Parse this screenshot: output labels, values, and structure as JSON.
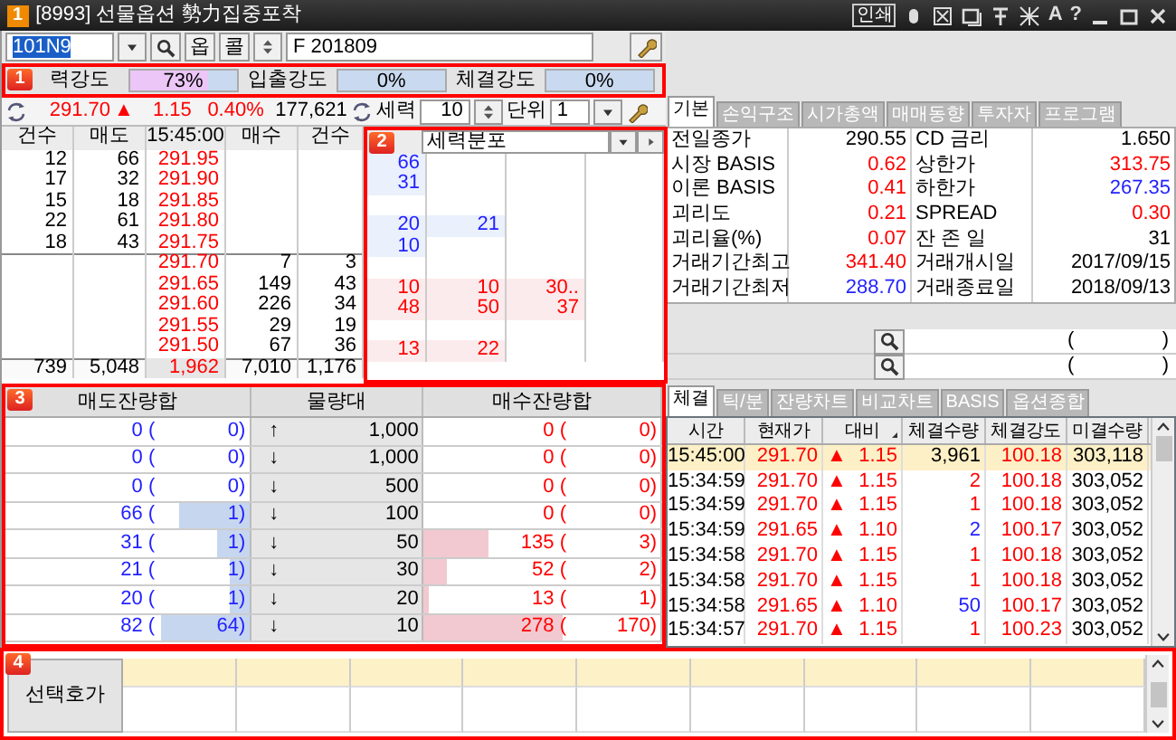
{
  "window": {
    "badge": "1",
    "title": "[8993] 선물옵션 勢力집중포착",
    "print_label": "인쇄",
    "tools": [
      "A",
      "?"
    ]
  },
  "toolbar": {
    "code": "101N9",
    "option_buttons": [
      "옵",
      "콜"
    ],
    "product": "F 201809"
  },
  "intensity": {
    "marker": "1",
    "items": [
      {
        "label": "력강도",
        "value": "73%",
        "level": 0.73
      },
      {
        "label": "입출강도",
        "value": "0%",
        "level": 0
      },
      {
        "label": "체결강도",
        "value": "0%",
        "level": 0
      }
    ]
  },
  "quote": {
    "price": "291.70",
    "arrow": "▲",
    "change": "1.15",
    "rate": "0.40%",
    "volume": "177,621",
    "force_label": "세력",
    "force_value": "10",
    "unit_label": "단위",
    "unit_value": "1"
  },
  "orderbook": {
    "columns": [
      "건수",
      "매도",
      "15:45:00",
      "매수",
      "건수"
    ],
    "asks": [
      {
        "count": "12",
        "qty": "66",
        "price": "291.95",
        "distribution": [
          "66"
        ]
      },
      {
        "count": "17",
        "qty": "32",
        "price": "291.90",
        "distribution": [
          "31"
        ]
      },
      {
        "count": "15",
        "qty": "18",
        "price": "291.85"
      },
      {
        "count": "22",
        "qty": "61",
        "price": "291.80",
        "distribution": [
          "20",
          "21"
        ]
      },
      {
        "count": "18",
        "qty": "43",
        "price": "291.75",
        "distribution": [
          "10"
        ]
      }
    ],
    "bids": [
      {
        "price": "291.70",
        "qty": "7",
        "count": "3"
      },
      {
        "price": "291.65",
        "qty": "149",
        "count": "43",
        "distribution": [
          "10",
          "10",
          "30.."
        ]
      },
      {
        "price": "291.60",
        "qty": "226",
        "count": "34",
        "distribution": [
          "48",
          "50",
          "37"
        ]
      },
      {
        "price": "291.55",
        "qty": "29",
        "count": "19"
      },
      {
        "price": "291.50",
        "qty": "67",
        "count": "36",
        "distribution": [
          "13",
          "22"
        ]
      }
    ],
    "totals": [
      "739",
      "5,048",
      "1,962",
      "7,010",
      "1,176"
    ]
  },
  "force_distribution": {
    "marker": "2",
    "select": "세력분포"
  },
  "remaining": {
    "marker": "3",
    "columns": [
      "매도잔량합",
      "물량대",
      "매수잔량합"
    ],
    "rows": [
      {
        "ask": {
          "qty": "0 (",
          "count": "0)",
          "level": 0
        },
        "arrow": "↑",
        "band": "1,000",
        "bid": {
          "qty": "0 (",
          "count": "0)",
          "level": 0
        }
      },
      {
        "ask": {
          "qty": "0 (",
          "count": "0)",
          "level": 0
        },
        "arrow": "↓",
        "band": "1,000",
        "bid": {
          "qty": "0 (",
          "count": "0)",
          "level": 0
        }
      },
      {
        "ask": {
          "qty": "0 (",
          "count": "0)",
          "level": 0
        },
        "arrow": "↓",
        "band": "500",
        "bid": {
          "qty": "0 (",
          "count": "0)",
          "level": 0
        }
      },
      {
        "ask": {
          "qty": "66 (",
          "count": "1)",
          "level": 0.29
        },
        "arrow": "↓",
        "band": "100",
        "bid": {
          "qty": "0 (",
          "count": "0)",
          "level": 0
        }
      },
      {
        "ask": {
          "qty": "31 (",
          "count": "1)",
          "level": 0.13
        },
        "arrow": "↓",
        "band": "50",
        "bid": {
          "qty": "135 (",
          "count": "3)",
          "level": 0.27
        }
      },
      {
        "ask": {
          "qty": "21 (",
          "count": "1)",
          "level": 0.08
        },
        "arrow": "↓",
        "band": "30",
        "bid": {
          "qty": "52 (",
          "count": "2)",
          "level": 0.1
        }
      },
      {
        "ask": {
          "qty": "20 (",
          "count": "1)",
          "level": 0.08
        },
        "arrow": "↓",
        "band": "20",
        "bid": {
          "qty": "13 (",
          "count": "1)",
          "level": 0.02
        }
      },
      {
        "ask": {
          "qty": "82 (",
          "count": "64)",
          "level": 0.36
        },
        "arrow": "↓",
        "band": "10",
        "bid": {
          "qty": "278 (",
          "count": "170)",
          "level": 0.59
        }
      }
    ]
  },
  "selected_quotes": {
    "marker": "4",
    "label": "선택호가"
  },
  "info_tabs": [
    {
      "label": "기본",
      "selected": true
    },
    {
      "label": "손익구조",
      "selected": false
    },
    {
      "label": "시가총액",
      "selected": false
    },
    {
      "label": "매매동향",
      "selected": false
    },
    {
      "label": "투자자",
      "selected": false
    },
    {
      "label": "프로그램",
      "selected": false
    }
  ],
  "info": [
    {
      "label": "전일종가",
      "value": "290.55",
      "rise": false,
      "fall": false
    },
    {
      "label": "CD 금리",
      "value": "1.650",
      "rise": false,
      "fall": false
    },
    {
      "label": "시장 BASIS",
      "value": "0.62",
      "rise": true,
      "fall": false
    },
    {
      "label": "상한가",
      "value": "313.75",
      "rise": true,
      "fall": false
    },
    {
      "label": "이론 BASIS",
      "value": "0.41",
      "rise": true,
      "fall": false
    },
    {
      "label": "하한가",
      "value": "267.35",
      "rise": false,
      "fall": true
    },
    {
      "label": "괴리도",
      "value": "0.21",
      "rise": true,
      "fall": false
    },
    {
      "label": "SPREAD",
      "value": "0.30",
      "rise": true,
      "fall": false
    },
    {
      "label": "괴리율(%)",
      "value": "0.07",
      "rise": true,
      "fall": false
    },
    {
      "label": "잔 존 일",
      "value": "31",
      "rise": false,
      "fall": false
    },
    {
      "label": "거래기간최고",
      "value": "341.40",
      "rise": true,
      "fall": false
    },
    {
      "label": "거래개시일",
      "value": "2017/09/15",
      "rise": false,
      "fall": false
    },
    {
      "label": "거래기간최저",
      "value": "288.70",
      "rise": false,
      "fall": true
    },
    {
      "label": "거래종료일",
      "value": "2018/09/13",
      "rise": false,
      "fall": false
    }
  ],
  "lookups": [
    {
      "open": "(",
      "close": ")"
    },
    {
      "open": "(",
      "close": ")"
    }
  ],
  "trade_tabs": [
    {
      "label": "체결",
      "selected": true
    },
    {
      "label": "틱/분",
      "selected": false
    },
    {
      "label": "잔량차트",
      "selected": false
    },
    {
      "label": "비교차트",
      "selected": false
    },
    {
      "label": "BASIS",
      "selected": false
    },
    {
      "label": "옵션종합",
      "selected": false
    }
  ],
  "trades": {
    "columns": [
      "시간",
      "현재가",
      "대비",
      "체결수량",
      "체결강도",
      "미결수량"
    ],
    "rows": [
      {
        "time": "15:45:00",
        "price": "291.70",
        "arrow": "▲",
        "change": "1.15",
        "qty": "3,961",
        "qty_rise": false,
        "qty_fall": false,
        "strength": "100.18",
        "open_interest": "303,118",
        "selected": true
      },
      {
        "time": "15:34:59",
        "price": "291.70",
        "arrow": "▲",
        "change": "1.15",
        "qty": "2",
        "qty_rise": true,
        "qty_fall": false,
        "strength": "100.18",
        "open_interest": "303,052",
        "selected": false
      },
      {
        "time": "15:34:59",
        "price": "291.70",
        "arrow": "▲",
        "change": "1.15",
        "qty": "1",
        "qty_rise": true,
        "qty_fall": false,
        "strength": "100.18",
        "open_interest": "303,052",
        "selected": false
      },
      {
        "time": "15:34:59",
        "price": "291.65",
        "arrow": "▲",
        "change": "1.10",
        "qty": "2",
        "qty_rise": false,
        "qty_fall": true,
        "strength": "100.17",
        "open_interest": "303,052",
        "selected": false
      },
      {
        "time": "15:34:58",
        "price": "291.70",
        "arrow": "▲",
        "change": "1.15",
        "qty": "1",
        "qty_rise": true,
        "qty_fall": false,
        "strength": "100.18",
        "open_interest": "303,052",
        "selected": false
      },
      {
        "time": "15:34:58",
        "price": "291.70",
        "arrow": "▲",
        "change": "1.15",
        "qty": "1",
        "qty_rise": true,
        "qty_fall": false,
        "strength": "100.18",
        "open_interest": "303,052",
        "selected": false
      },
      {
        "time": "15:34:58",
        "price": "291.65",
        "arrow": "▲",
        "change": "1.10",
        "qty": "50",
        "qty_rise": false,
        "qty_fall": true,
        "strength": "100.17",
        "open_interest": "303,052",
        "selected": false
      },
      {
        "time": "15:34:57",
        "price": "291.70",
        "arrow": "▲",
        "change": "1.15",
        "qty": "1",
        "qty_rise": true,
        "qty_fall": false,
        "strength": "100.23",
        "open_interest": "303,052",
        "selected": false
      }
    ]
  }
}
